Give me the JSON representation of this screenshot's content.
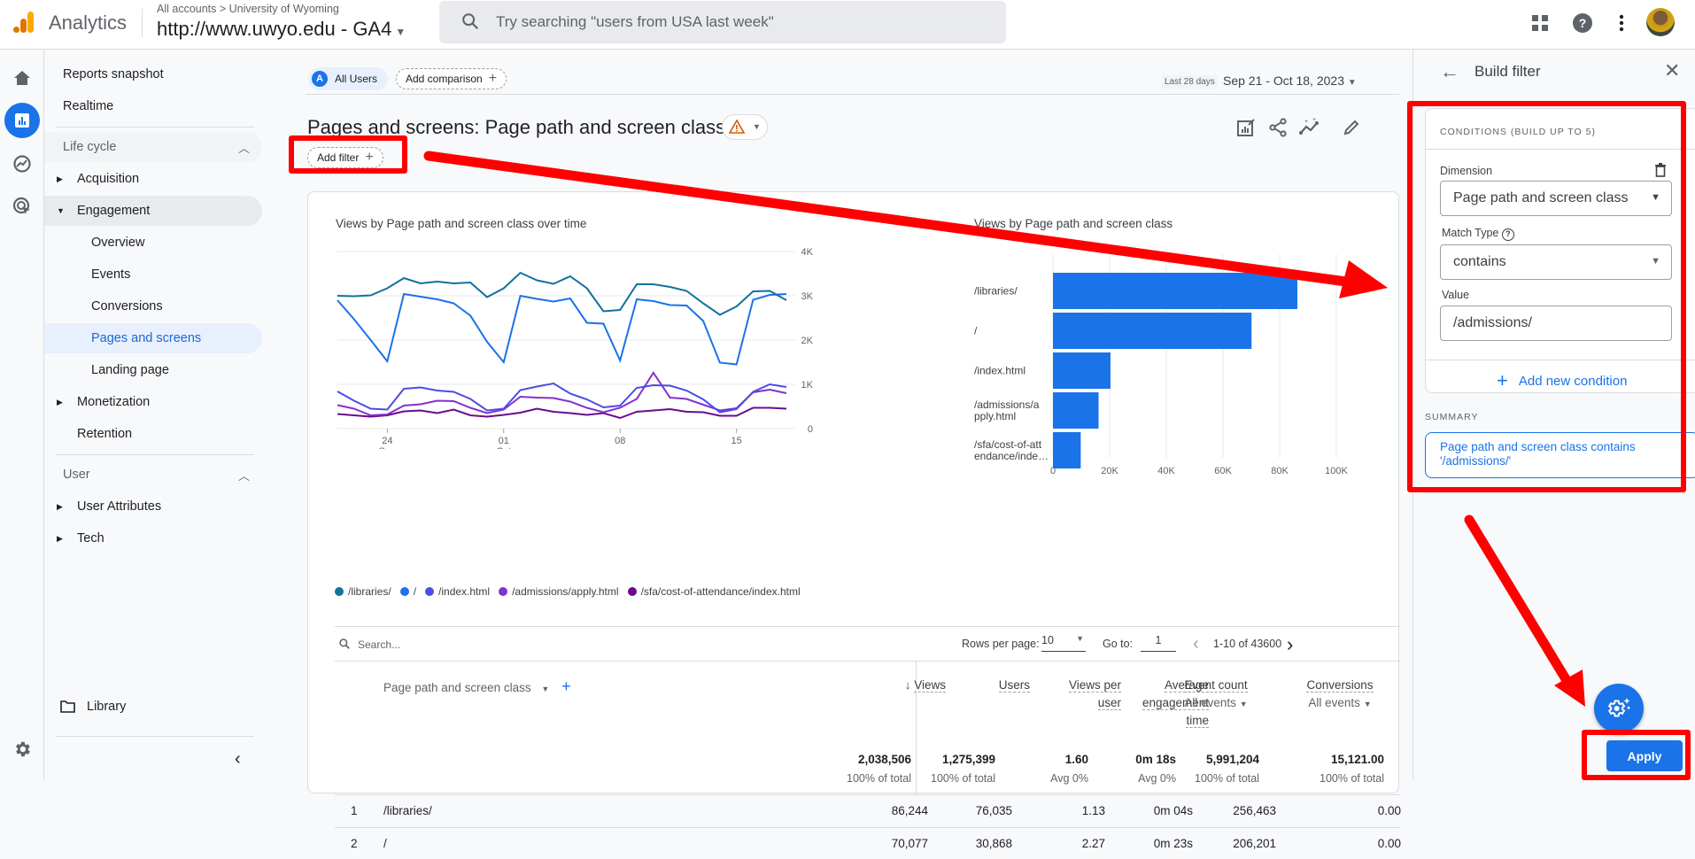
{
  "topbar": {
    "app_name": "Analytics",
    "breadcrumb": "All accounts > University of Wyoming",
    "property": "http://www.uwyo.edu - GA4",
    "search_placeholder": "Try searching \"users from USA last week\"",
    "icons": [
      "apps-grid-icon",
      "help-icon",
      "more-vert-icon",
      "avatar"
    ]
  },
  "rail": {
    "icons": [
      "home-icon",
      "reports-icon",
      "explore-icon",
      "advertising-icon",
      "settings-icon"
    ]
  },
  "nav": {
    "items": [
      {
        "label": "Reports snapshot"
      },
      {
        "label": "Realtime"
      },
      {
        "label": "Life cycle"
      },
      {
        "label": "Acquisition"
      },
      {
        "label": "Engagement"
      },
      {
        "label": "Overview"
      },
      {
        "label": "Events"
      },
      {
        "label": "Conversions"
      },
      {
        "label": "Pages and screens"
      },
      {
        "label": "Landing page"
      },
      {
        "label": "Monetization"
      },
      {
        "label": "Retention"
      },
      {
        "label": "User"
      },
      {
        "label": "User Attributes"
      },
      {
        "label": "Tech"
      }
    ],
    "library": "Library",
    "collapse_icon": "chevron-left-icon"
  },
  "main": {
    "segment": {
      "letter": "A",
      "label": "All Users"
    },
    "add_comparison": "Add comparison",
    "date_range_label": "Last 28 days",
    "date_range": "Sep 21 - Oct 18, 2023",
    "title": "Pages and screens: Page path and screen class",
    "add_filter": "Add filter",
    "line_chart_title": "Views by Page path and screen class over time",
    "bar_chart_title": "Views by Page path and screen class"
  },
  "chart_data": [
    {
      "type": "line",
      "title": "Views by Page path and screen class over time",
      "xlabel": "",
      "ylabel": "",
      "x": [
        "Sep 21",
        "Sep 22",
        "Sep 23",
        "Sep 24",
        "Sep 25",
        "Sep 26",
        "Sep 27",
        "Sep 28",
        "Sep 29",
        "Sep 30",
        "Oct 01",
        "Oct 02",
        "Oct 03",
        "Oct 04",
        "Oct 05",
        "Oct 06",
        "Oct 07",
        "Oct 08",
        "Oct 09",
        "Oct 10",
        "Oct 11",
        "Oct 12",
        "Oct 13",
        "Oct 14",
        "Oct 15",
        "Oct 16",
        "Oct 17",
        "Oct 18"
      ],
      "x_tick_labels": [
        {
          "label": "24",
          "sub": "Sep",
          "index": 3
        },
        {
          "label": "01",
          "sub": "Oct",
          "index": 10
        },
        {
          "label": "08",
          "sub": "",
          "index": 17
        },
        {
          "label": "15",
          "sub": "",
          "index": 24
        }
      ],
      "y_ticks": [
        "0",
        "1K",
        "2K",
        "3K",
        "4K"
      ],
      "ylim": [
        0,
        4000
      ],
      "grid": true,
      "legend_position": "bottom",
      "series": [
        {
          "name": "/libraries/",
          "color": "#12719e",
          "values": [
            3000,
            2990,
            3010,
            3170,
            3400,
            3280,
            3320,
            3280,
            3300,
            2970,
            3170,
            3520,
            3350,
            3270,
            3440,
            3170,
            2650,
            2680,
            3260,
            3260,
            3200,
            3110,
            2830,
            2570,
            2760,
            3100,
            3110,
            2900
          ]
        },
        {
          "name": "/",
          "color": "#1a73e8",
          "values": [
            2900,
            2470,
            2000,
            1520,
            3040,
            2980,
            2920,
            2830,
            2550,
            1960,
            1500,
            3000,
            2930,
            2870,
            2940,
            2390,
            2370,
            1540,
            2920,
            2880,
            2790,
            2780,
            2430,
            1490,
            1450,
            2910,
            3020,
            3040
          ]
        },
        {
          "name": "/index.html",
          "color": "#4c4ce6",
          "values": [
            840,
            630,
            450,
            430,
            900,
            930,
            860,
            830,
            670,
            410,
            450,
            870,
            950,
            1020,
            790,
            660,
            480,
            520,
            920,
            980,
            970,
            860,
            660,
            370,
            440,
            830,
            1000,
            940
          ]
        },
        {
          "name": "/admissions/apply.html",
          "color": "#8430ce",
          "values": [
            530,
            450,
            300,
            320,
            520,
            550,
            630,
            620,
            470,
            350,
            430,
            720,
            700,
            690,
            610,
            470,
            370,
            470,
            670,
            1260,
            700,
            670,
            540,
            410,
            460,
            820,
            880,
            800
          ]
        },
        {
          "name": "/sfa/cost-of-attendance/index.html",
          "color": "#6a0b8c",
          "values": [
            330,
            300,
            270,
            300,
            390,
            410,
            350,
            430,
            300,
            270,
            310,
            360,
            450,
            380,
            350,
            310,
            350,
            240,
            380,
            410,
            440,
            380,
            370,
            290,
            290,
            470,
            470,
            450
          ]
        }
      ]
    },
    {
      "type": "bar",
      "orientation": "horizontal",
      "title": "Views by Page path and screen class",
      "categories": [
        "/libraries/",
        "/",
        "/index.html",
        "/admissions/apply.html",
        "/sfa/cost-of-attendance/index.html"
      ],
      "category_labels": [
        [
          "/libraries/"
        ],
        [
          "/"
        ],
        [
          "/index.html"
        ],
        [
          "/admissions/a",
          "pply.html"
        ],
        [
          "/sfa/cost-of-att",
          "endance/inde…"
        ]
      ],
      "values": [
        86244,
        70077,
        20300,
        16100,
        9800
      ],
      "x_ticks": [
        "0",
        "20K",
        "40K",
        "60K",
        "80K",
        "100K"
      ],
      "xlim": [
        0,
        100000
      ],
      "color": "#1a73e8",
      "grid": true
    }
  ],
  "table": {
    "search_placeholder": "Search...",
    "rows_per_page_label": "Rows per page:",
    "rows_per_page": "10",
    "goto_label": "Go to:",
    "goto_value": "1",
    "range": "1-10 of 43600",
    "dimension_header": "Page path and screen class",
    "columns": [
      {
        "label": "Views",
        "sorted": "desc",
        "total": "2,038,506",
        "pct": "100% of total"
      },
      {
        "label": "Users",
        "total": "1,275,399",
        "pct": "100% of total"
      },
      {
        "label_lines": [
          "Views per",
          "user"
        ],
        "total": "1.60",
        "pct": "Avg 0%"
      },
      {
        "label_lines": [
          "Average",
          "engagement",
          "time"
        ],
        "total": "0m 18s",
        "pct": "Avg 0%"
      },
      {
        "label": "Event count",
        "sub": "All events",
        "total": "5,991,204",
        "pct": "100% of total"
      },
      {
        "label": "Conversions",
        "sub": "All events",
        "total": "15,121.00",
        "pct": "100% of total"
      }
    ],
    "rows": [
      {
        "n": "1",
        "path": "/libraries/",
        "cells": [
          "86,244",
          "76,035",
          "1.13",
          "0m 04s",
          "256,463",
          "0.00"
        ]
      },
      {
        "n": "2",
        "path": "/",
        "cells": [
          "70,077",
          "30,868",
          "2.27",
          "0m 23s",
          "206,201",
          "0.00"
        ]
      }
    ]
  },
  "panel": {
    "title": "Build filter",
    "conditions_header": "CONDITIONS (BUILD UP TO 5)",
    "dimension_label": "Dimension",
    "dimension_value": "Page path and screen class",
    "match_type_label": "Match Type",
    "match_type_value": "contains",
    "value_label": "Value",
    "value": "/admissions/",
    "add_condition": "Add new condition",
    "summary_label": "SUMMARY",
    "summary_text": "Page path and screen class contains '/admissions/'",
    "apply": "Apply"
  },
  "annotations": {
    "color": "#ff0000",
    "arrows": 3,
    "boxes": 3
  }
}
